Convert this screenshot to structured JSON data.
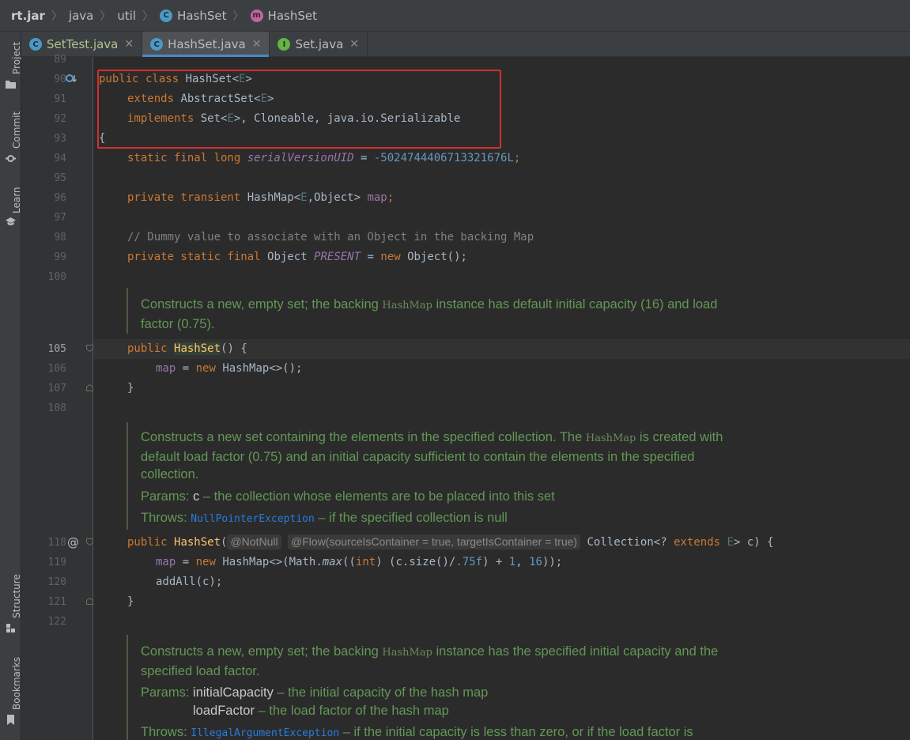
{
  "breadcrumb": {
    "items": [
      "rt.jar",
      "java",
      "util",
      "HashSet",
      "HashSet"
    ]
  },
  "toolwindows": {
    "project": "Project",
    "commit": "Commit",
    "learn": "Learn",
    "structure": "Structure",
    "bookmarks": "Bookmarks"
  },
  "tabs": [
    {
      "label": "SetTest.java"
    },
    {
      "label": "HashSet.java"
    },
    {
      "label": "Set.java"
    }
  ],
  "line_numbers": {
    "n89": "89",
    "n90": "90",
    "n91": "91",
    "n92": "92",
    "n93": "93",
    "n94": "94",
    "n95": "95",
    "n96": "96",
    "n97": "97",
    "n98": "98",
    "n99": "99",
    "n100": "100",
    "n105": "105",
    "n106": "106",
    "n107": "107",
    "n108": "108",
    "n118": "118",
    "n119": "119",
    "n120": "120",
    "n121": "121",
    "n122": "122"
  },
  "code": {
    "l90": {
      "kw": "public class ",
      "name": "HashSet<",
      "tp": "E",
      "end": ">"
    },
    "l91": {
      "kw": "extends ",
      "name": "AbstractSet<",
      "tp": "E",
      "end": ">"
    },
    "l92": {
      "kw": "implements ",
      "set": "Set<",
      "tp": "E",
      "rest": ">, Cloneable, java.io.Serializable"
    },
    "l93": "{",
    "l94": {
      "kw": "static final long ",
      "field": "serialVersionUID",
      "eq": " = ",
      "num": "-5024744406713321676L",
      "semi": ";"
    },
    "l96": {
      "kw": "private transient ",
      "type": "HashMap<",
      "tp": "E",
      "rest": ",Object> ",
      "field": "map",
      "semi": ";"
    },
    "l98": "// Dummy value to associate with an Object in the backing Map",
    "l99": {
      "kw": "private static final ",
      "type": "Object ",
      "field": "PRESENT",
      "eq": " = ",
      "kw2": "new ",
      "rest": "Object();"
    },
    "l105": {
      "kw": "public ",
      "name": "HashSet",
      "rest": "() {"
    },
    "l106": {
      "field": "map",
      "eq": " = ",
      "kw": "new ",
      "rest": "HashMap<>();"
    },
    "l107": "}",
    "l118": {
      "kw": "public ",
      "name": "HashSet",
      "paren": "(",
      "ann1": "@NotNull",
      "ann2": "@Flow(sourceIsContainer = true, targetIsContainer = true)",
      "rest1": " Collection<? ",
      "kw2": "extends ",
      "tp": "E",
      "rest2": "> c) {"
    },
    "l119": {
      "field": "map",
      "eq": " = ",
      "kw": "new ",
      "rest1": "HashMap<>(Math.",
      "method": "max",
      "rest2": "((",
      "kw2": "int",
      "rest3": ") (c.size()/",
      "num1": ".75f",
      "rest4": ") + ",
      "num2": "1",
      "rest5": ", ",
      "num3": "16",
      "rest6": "));"
    },
    "l120": "addAll(c);",
    "l121": "}"
  },
  "docs": {
    "d1": {
      "pre": "Constructs a new, empty set; the backing ",
      "code": "HashMap",
      "post": " instance has default initial capacity (16) and load",
      "line2": "factor (0.75)."
    },
    "d2": {
      "pre": "Constructs a new set containing the elements in the specified collection. The ",
      "code": "HashMap",
      "post": " is created with",
      "line2": "default load factor (0.75) and an initial capacity sufficient to contain the elements in the specified",
      "line3": "collection.",
      "params_label": "Params: ",
      "param": "c",
      "param_desc": " – the collection whose elements are to be placed into this set",
      "throws_label": "Throws: ",
      "exception": "NullPointerException",
      "throws_desc": " – if the specified collection is null"
    },
    "d3": {
      "pre": "Constructs a new, empty set; the backing ",
      "code": "HashMap",
      "post": " instance has the specified initial capacity and the",
      "line2": "specified load factor.",
      "params_label": "Params: ",
      "param1": "initialCapacity",
      "param1_desc": " – the initial capacity of the hash map",
      "param2": "loadFactor",
      "param2_desc": " – the load factor of the hash map",
      "throws_label": "Throws: ",
      "exception": "IllegalArgumentException",
      "throws_desc": " – if the initial capacity is less than zero, or if the load factor is"
    }
  },
  "colors": {
    "keyword": "#cc7832",
    "field": "#9876aa",
    "number": "#6897bb",
    "doc": "#629755",
    "highlight_box": "#d32f2f"
  }
}
